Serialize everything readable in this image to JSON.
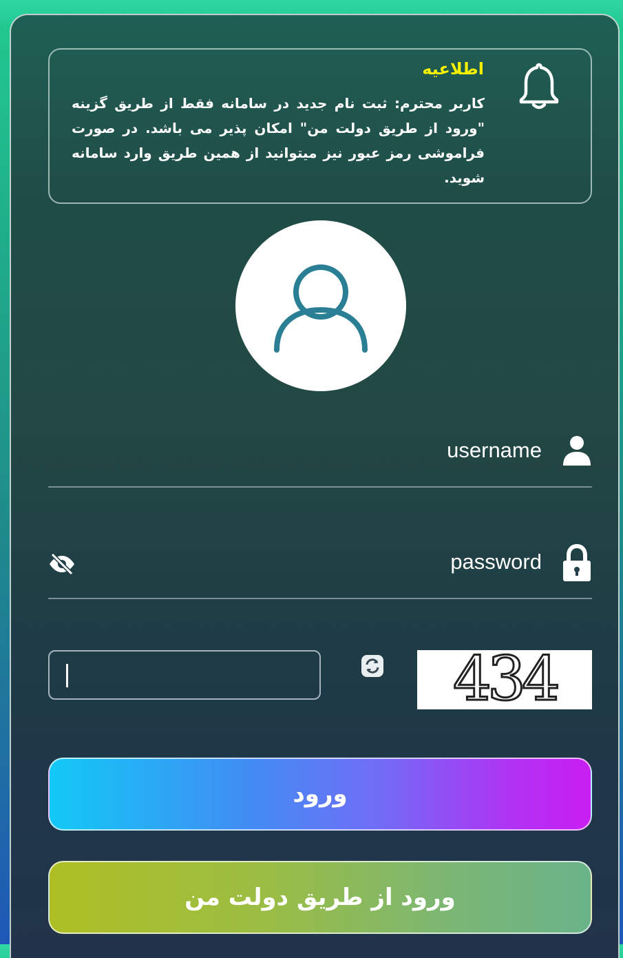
{
  "notice": {
    "title": "اطلاعیه",
    "icon": "bell-icon",
    "text": "کاربر محترم: ثبت نام جدید در سامانه فقط از طریق گزینه \"ورود از طریق دولت من\" امکان پذیر می باشد. در صورت فراموشی رمز عبور نیز میتوانید از همین طریق وارد سامانه شوید."
  },
  "avatar": {
    "icon": "user-avatar-icon"
  },
  "username": {
    "label": "username",
    "icon": "user-icon"
  },
  "password": {
    "label": "password",
    "icon": "lock-icon",
    "toggle_icon": "eye-slash-icon"
  },
  "captcha": {
    "input_value": "",
    "image_text": "434",
    "refresh_icon": "refresh-icon"
  },
  "buttons": {
    "login": "ورود",
    "gov_login": "ورود از طریق دولت من"
  },
  "colors": {
    "notice_title": "#f5ef00",
    "login_gradient_start": "#12c9f6",
    "login_gradient_end": "#c81ef2",
    "gov_gradient_start": "#aebf24",
    "gov_gradient_end": "#6ab38a"
  }
}
